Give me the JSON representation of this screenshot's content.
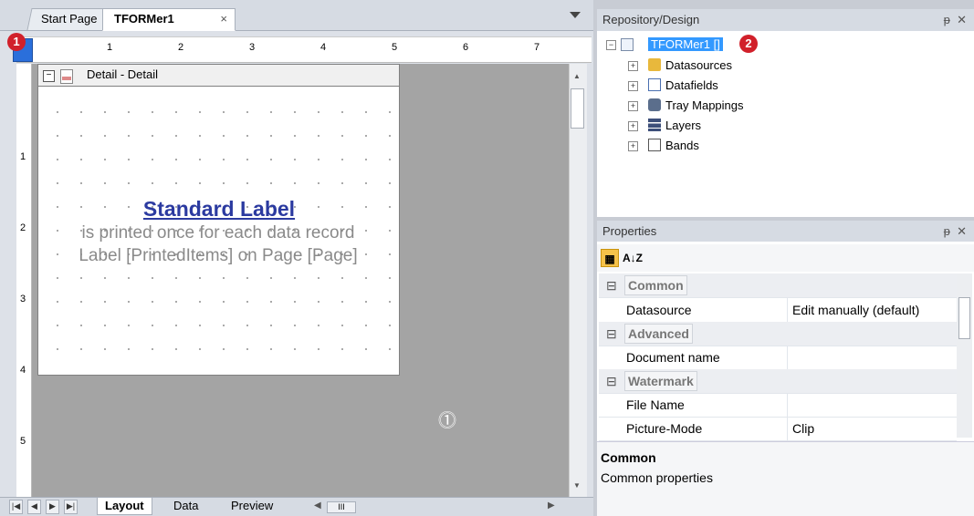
{
  "document_tabs": {
    "start_page": "Start Page",
    "active_tab": "TFORMer1",
    "close_glyph": "×"
  },
  "markers": {
    "m1": "1",
    "m2": "2"
  },
  "ruler": {
    "h_numbers": [
      "1",
      "2",
      "3",
      "4",
      "5",
      "6",
      "7"
    ],
    "v_numbers": [
      "1",
      "2",
      "3",
      "4",
      "5"
    ]
  },
  "band": {
    "title": "Detail - Detail",
    "collapse_glyph": "−"
  },
  "label": {
    "title": "Standard Label",
    "line2": "is printed once for each data record",
    "line3": "Label [PrintedItems] on Page [Page]"
  },
  "canvas": {
    "anchor_glyph": "⓵"
  },
  "bottom_tabs": [
    "Layout",
    "Data",
    "Preview"
  ],
  "bottom_nav": [
    "|◀",
    "◀",
    "▶",
    "▶|"
  ],
  "hscroll": {
    "thumb": "III"
  },
  "repository": {
    "title": "Repository/Design",
    "pin": "ᵽ",
    "close": "✕",
    "root": "TFORMer1 []",
    "items": [
      "Datasources",
      "Datafields",
      "Tray Mappings",
      "Layers",
      "Bands"
    ]
  },
  "properties": {
    "title": "Properties",
    "toolbar": {
      "categorized": "▦",
      "alphabetical": "A↓Z"
    },
    "rows": [
      {
        "type": "category",
        "name": "Common"
      },
      {
        "type": "prop",
        "name": "Datasource",
        "value": "Edit manually (default)"
      },
      {
        "type": "category",
        "name": "Advanced"
      },
      {
        "type": "prop",
        "name": "Document name",
        "value": ""
      },
      {
        "type": "category",
        "name": "Watermark"
      },
      {
        "type": "prop",
        "name": "File Name",
        "value": ""
      },
      {
        "type": "prop",
        "name": "Picture-Mode",
        "value": "Clip"
      }
    ],
    "description_title": "Common",
    "description_text": "Common properties"
  },
  "colors": {
    "accent": "#3399ff",
    "label_title": "#2b3aa0",
    "marker": "#d1202a"
  }
}
